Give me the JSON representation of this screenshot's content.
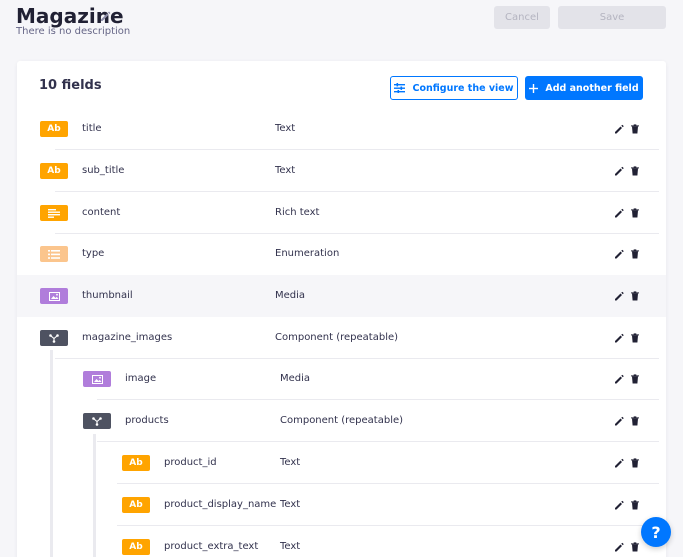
{
  "header": {
    "title": "Magazine",
    "description": "There is no description",
    "cancel_label": "Cancel",
    "save_label": "Save"
  },
  "card": {
    "fields_count": "10 fields",
    "configure_label": "Configure the view",
    "add_label": "Add another field"
  },
  "colors": {
    "accent": "#0077ff",
    "text_badge": "#ffa400",
    "richtext_badge": "#ffa400",
    "enum_badge": "#fbc58d",
    "media_badge": "#b07ddb",
    "component_badge": "#4e5261"
  },
  "fields": [
    {
      "name": "title",
      "type": "Text",
      "badge": "Ab",
      "kind": "text"
    },
    {
      "name": "sub_title",
      "type": "Text",
      "badge": "Ab",
      "kind": "text"
    },
    {
      "name": "content",
      "type": "Rich text",
      "badge": "",
      "kind": "richtext"
    },
    {
      "name": "type",
      "type": "Enumeration",
      "badge": "",
      "kind": "enum"
    },
    {
      "name": "thumbnail",
      "type": "Media",
      "badge": "",
      "kind": "media"
    },
    {
      "name": "magazine_images",
      "type": "Component (repeatable)",
      "badge": "",
      "kind": "component"
    },
    {
      "name": "image",
      "type": "Media",
      "badge": "",
      "kind": "media"
    },
    {
      "name": "products",
      "type": "Component (repeatable)",
      "badge": "",
      "kind": "component"
    },
    {
      "name": "product_id",
      "type": "Text",
      "badge": "Ab",
      "kind": "text"
    },
    {
      "name": "product_display_name",
      "type": "Text",
      "badge": "Ab",
      "kind": "text"
    },
    {
      "name": "product_extra_text",
      "type": "Text",
      "badge": "Ab",
      "kind": "text"
    }
  ],
  "help_label": "?"
}
